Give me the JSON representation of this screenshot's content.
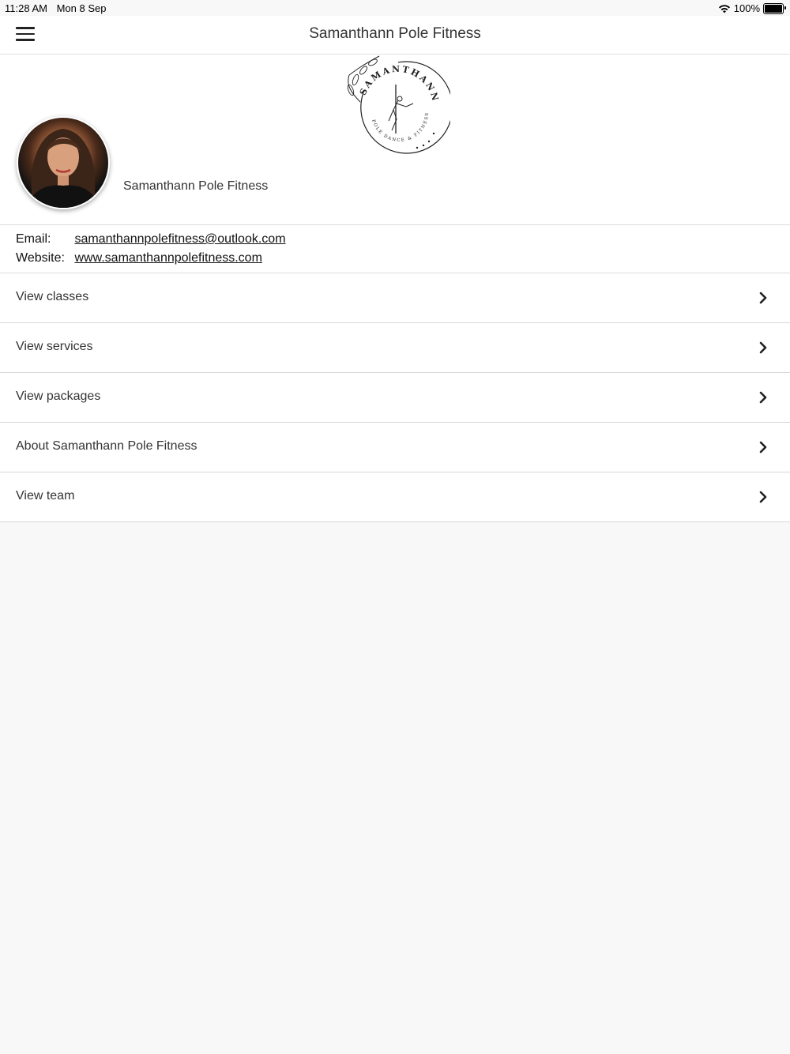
{
  "status": {
    "time": "11:28 AM",
    "date": "Mon 8 Sep",
    "battery": "100%",
    "battery_level": 1.0
  },
  "nav": {
    "title": "Samanthann Pole Fitness"
  },
  "logo": {
    "top_text": "SAMANTHANN",
    "bottom_text": "POLE DANCE & FITNESS"
  },
  "profile": {
    "name": "Samanthann Pole Fitness"
  },
  "contact": {
    "email_label": "Email:",
    "email": "samanthannpolefitness@outlook.com",
    "website_label": "Website:",
    "website": "www.samanthannpolefitness.com"
  },
  "menu": {
    "items": [
      {
        "label": "View classes"
      },
      {
        "label": "View services"
      },
      {
        "label": "View packages"
      },
      {
        "label": "About Samanthann Pole Fitness"
      },
      {
        "label": "View team"
      }
    ]
  }
}
